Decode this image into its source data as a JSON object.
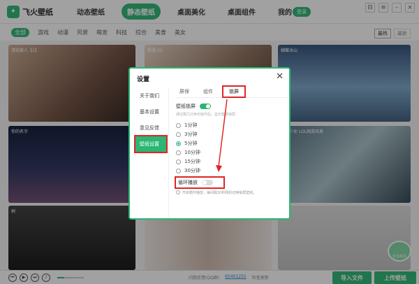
{
  "app": {
    "name": "飞火壁纸"
  },
  "nav": {
    "items": [
      "动态壁纸",
      "静态壁纸",
      "桌面美化",
      "桌面组件",
      "我的"
    ],
    "active_index": 1
  },
  "header": {
    "login_label": "登录"
  },
  "categories": {
    "items": [
      "全部",
      "游戏",
      "动漫",
      "风景",
      "萌宠",
      "科技",
      "综合",
      "美食",
      "美女"
    ],
    "active_index": 0
  },
  "sort": {
    "options": [
      "最热",
      "最新"
    ]
  },
  "thumbs": {
    "t1": "清纯美人【1】",
    "t2": "動漫-02",
    "t3": "蝴蝶冰山",
    "t4": "你的名字",
    "t6": "星辰少女 LOL网游风景",
    "t7": "树"
  },
  "bottombar": {
    "info_prefix": "问题反馈(QQ群)",
    "qq": "65401255",
    "check_update": "检查更新",
    "import_label": "导入文件",
    "upload_label": "上传壁纸"
  },
  "mascot": {
    "label": "反馈意见"
  },
  "dialog": {
    "title": "设置",
    "sidebar": [
      "关于我们",
      "基本设置",
      "意见反馈",
      "壁纸设置"
    ],
    "sidebar_active_index": 3,
    "tabs": [
      "屏保",
      "组件",
      "锁屏"
    ],
    "tab_active_index": 2,
    "lock_label": "壁纸锁屏",
    "lock_hint": "通过隔几分钟无操作后，显示壁纸锁屏",
    "intervals": [
      "1分钟",
      "3分钟",
      "5分钟",
      "10分钟",
      "15分钟",
      "30分钟"
    ],
    "interval_selected": 2,
    "loop_label": "循环播放",
    "loop_hint": "开启循环播放，每间隔30秒随机切换锁屏壁纸。"
  },
  "colors": {
    "accent": "#2bb673",
    "highlight": "#e02424"
  }
}
